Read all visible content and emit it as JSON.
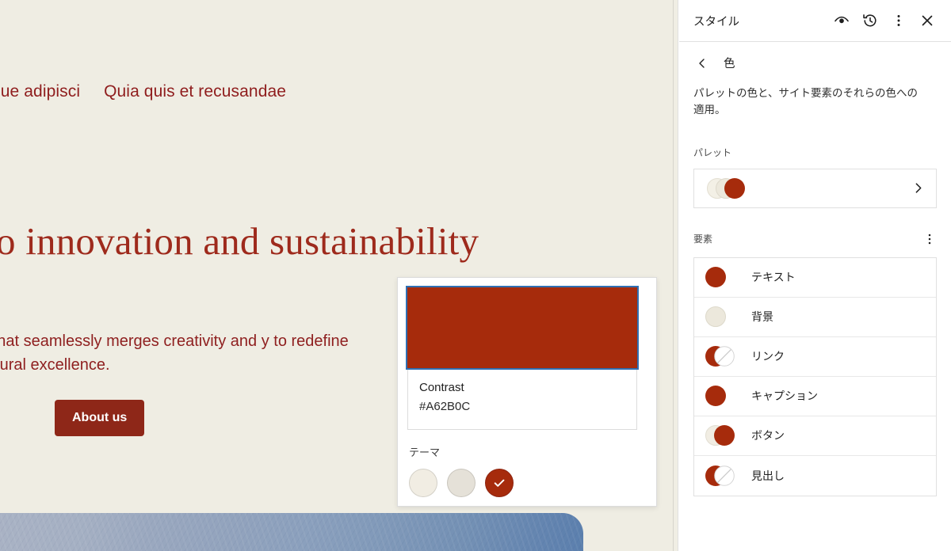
{
  "canvas": {
    "background_color": "#efede3",
    "nav": [
      {
        "label": "non atque adipisci"
      },
      {
        "label": "Quia quis et recusandae"
      }
    ],
    "hero": {
      "heading": "ment to innovation and sustainability",
      "body": "ng firm that seamlessly merges creativity and y to redefine architectural excellence.",
      "button_label": "About us",
      "button_color": "#8e2718",
      "text_color": "#9e2a1c"
    },
    "image_block": {
      "name": "hero-image",
      "color_from": "#a9b2c4",
      "color_to": "#5b7fad"
    }
  },
  "popover": {
    "swatch_color": "#a62b0c",
    "focus_ring_color": "#2f6fb3",
    "color_name": "Contrast",
    "color_hex": "#A62B0C",
    "theme_label": "テーマ",
    "theme_swatches": [
      {
        "name": "base",
        "color": "#f1ede3",
        "selected": false
      },
      {
        "name": "contrast-light",
        "color": "#e5e1d8",
        "selected": false
      },
      {
        "name": "contrast",
        "color": "#a62b0c",
        "selected": true
      }
    ]
  },
  "sidebar": {
    "title": "スタイル",
    "header_icons": [
      {
        "name": "style-book-icon",
        "glyph": "eye"
      },
      {
        "name": "revisions-icon",
        "glyph": "history"
      },
      {
        "name": "more-options-icon",
        "glyph": "ellipsis"
      },
      {
        "name": "close-icon",
        "glyph": "close"
      }
    ],
    "back_label": "戻る",
    "section_title": "色",
    "description": "パレットの色と、サイト要素のそれらの色への適用。",
    "palette": {
      "label": "パレット",
      "colors": [
        "#f3f0e6",
        "#ece8dc",
        "#a62b0c"
      ]
    },
    "elements": {
      "label": "要素",
      "items": [
        {
          "label": "テキスト",
          "type": "solid",
          "front": "#a62b0c",
          "back": null
        },
        {
          "label": "背景",
          "type": "solid",
          "front": "#ece8dc",
          "back": null
        },
        {
          "label": "リンク",
          "type": "pair-none",
          "front": "none",
          "back": "#a62b0c"
        },
        {
          "label": "キャプション",
          "type": "solid",
          "front": "#a62b0c",
          "back": null
        },
        {
          "label": "ボタン",
          "type": "pair",
          "front": "#a62b0c",
          "back": "#f1ede3"
        },
        {
          "label": "見出し",
          "type": "pair-none",
          "front": "none",
          "back": "#a62b0c"
        }
      ]
    }
  }
}
